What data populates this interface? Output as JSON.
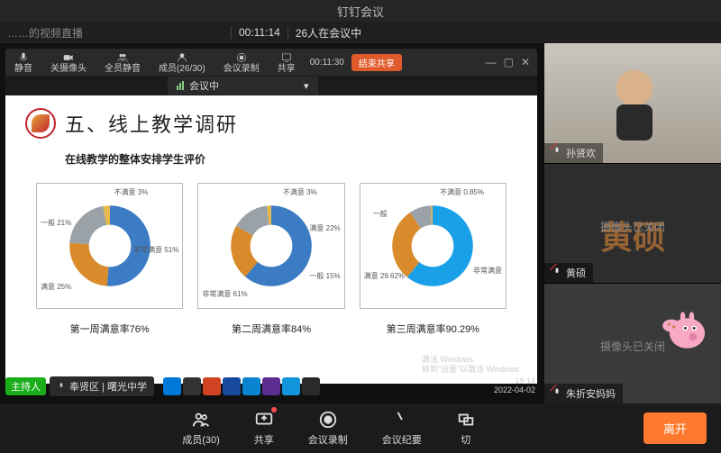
{
  "window": {
    "title": "钉钉会议"
  },
  "info": {
    "subtitle": "……的视频直播",
    "elapsed": "00:11:14",
    "people_status": "26人在会议中"
  },
  "floatbar": {
    "mute": "静音",
    "camera": "关摄像头",
    "mute_all": "全员静音",
    "members": "成员(26/30)",
    "record": "会议录制",
    "share": "共享",
    "timer": "00:11:30",
    "record_btn": "结束共享"
  },
  "status": {
    "in_meeting": "会议中"
  },
  "slide": {
    "title": "五、线上教学调研",
    "subtitle": "在线教学的整体安排学生评价",
    "chart1_caption": "第一周满意率76%",
    "chart2_caption": "第二周满意率84%",
    "chart3_caption": "第三周满意率90.29%",
    "watermark1": "激活 Windows",
    "watermark2": "转到“设置”以激活 Windows"
  },
  "chart_data": [
    {
      "type": "pie",
      "title": "第一周满意率76%",
      "series": [
        {
          "name": "非常满意",
          "value": 51,
          "color": "#3b7cc4"
        },
        {
          "name": "满意",
          "value": 25,
          "color": "#d98b2b"
        },
        {
          "name": "一般",
          "value": 21,
          "color": "#9aa2a8"
        },
        {
          "name": "不满意",
          "value": 3,
          "color": "#e6b84d"
        }
      ]
    },
    {
      "type": "pie",
      "title": "第二周满意率84%",
      "series": [
        {
          "name": "非常满意",
          "value": 61,
          "color": "#3b7cc4"
        },
        {
          "name": "满意",
          "value": 22,
          "color": "#d98b2b"
        },
        {
          "name": "一般",
          "value": 15,
          "color": "#9aa2a8"
        },
        {
          "name": "不满意",
          "value": 3,
          "color": "#e6b84d"
        }
      ]
    },
    {
      "type": "pie",
      "title": "第三周满意率90.29%",
      "series": [
        {
          "name": "非常满意",
          "value": 60.72,
          "color": "#1aa0e8"
        },
        {
          "name": "满意",
          "value": 29.62,
          "color": "#d98b2b"
        },
        {
          "name": "一般",
          "value": 8.8,
          "color": "#9aa2a8"
        },
        {
          "name": "不满意",
          "value": 0.85,
          "color": "#e6b84d"
        }
      ]
    }
  ],
  "stage_footer": {
    "host_badge": "主持人",
    "location": "奉贤区 | 曙光中学",
    "clock_time": "19:14",
    "clock_date": "2022-04-02"
  },
  "participants": [
    {
      "name": "孙贤欢",
      "cam_off": false
    },
    {
      "name": "黄硕",
      "cam_off": true,
      "big": "黄硕",
      "cam_off_text": "摄像头已关闭"
    },
    {
      "name": "朱折安妈妈",
      "cam_off": true,
      "cam_off_text": "摄像头已关闭"
    }
  ],
  "bottombar": {
    "members": "成员(30)",
    "share": "共享",
    "record": "会议录制",
    "minutes": "会议纪要",
    "switch": "切",
    "leave": "离开"
  },
  "chart_labels": {
    "c1_a": "非常满意 51%",
    "c1_b": "满意 25%",
    "c1_c": "一般 21%",
    "c1_d": "不满意 3%",
    "c2_a": "非常满意 61%",
    "c2_b": "满意 22%",
    "c2_c": "一般 15%",
    "c2_d": "不满意 3%",
    "c3_a": "非常满意",
    "c3_b": "满意 29.62%",
    "c3_c": "一般",
    "c3_d": "不满意 0.85%"
  }
}
